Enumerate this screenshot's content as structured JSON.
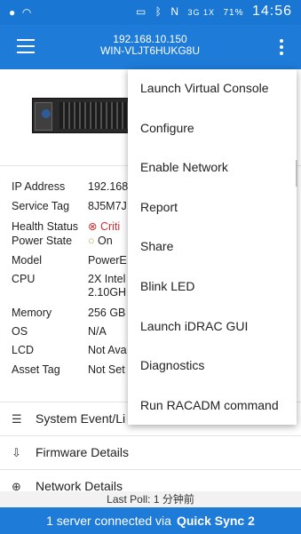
{
  "statusbar": {
    "left_icons": [
      "●",
      "wifi",
      "cast",
      "bluetooth",
      "N",
      "battery-save"
    ],
    "signal": "3G 1X",
    "battery": "71%",
    "time": "14:56"
  },
  "appbar": {
    "ip": "192.168.10.150",
    "host": "WIN-VLJT6HUKG8U"
  },
  "details": [
    {
      "label": "IP Address",
      "value": "192.168"
    },
    {
      "label": "Service Tag",
      "value": "8J5M7J"
    },
    {
      "label": "Health Status",
      "value": "Criti"
    },
    {
      "label": "Power State",
      "value": "On"
    },
    {
      "label": "Model",
      "value": "PowerE"
    },
    {
      "label": "CPU",
      "value": "2X Intel"
    },
    {
      "label": "CPU_line2",
      "value": "2.10GH"
    },
    {
      "label": "Memory",
      "value": "256 GB"
    },
    {
      "label": "OS",
      "value": "N/A"
    },
    {
      "label": "LCD",
      "value": "Not Ava"
    },
    {
      "label": "Asset Tag",
      "value": "Not Set"
    }
  ],
  "list_items": [
    {
      "label": "System Event/Li",
      "icon": "event-log-icon"
    },
    {
      "label": "Firmware Details",
      "icon": "firmware-icon"
    },
    {
      "label": "Network Details",
      "icon": "network-icon"
    }
  ],
  "menu": [
    "Launch Virtual Console",
    "Configure",
    "Enable Network",
    "Report",
    "Share",
    "Blink LED",
    "Launch iDRAC GUI",
    "Diagnostics",
    "Run RACADM command"
  ],
  "footer": {
    "last_poll": "Last Poll: 1 分钟前",
    "connected_prefix": "1 server connected via",
    "connected_via": "Quick Sync 2"
  },
  "colors": {
    "accent": "#1e7bd8",
    "critical": "#d32f2f",
    "ok": "#9aa84a"
  }
}
